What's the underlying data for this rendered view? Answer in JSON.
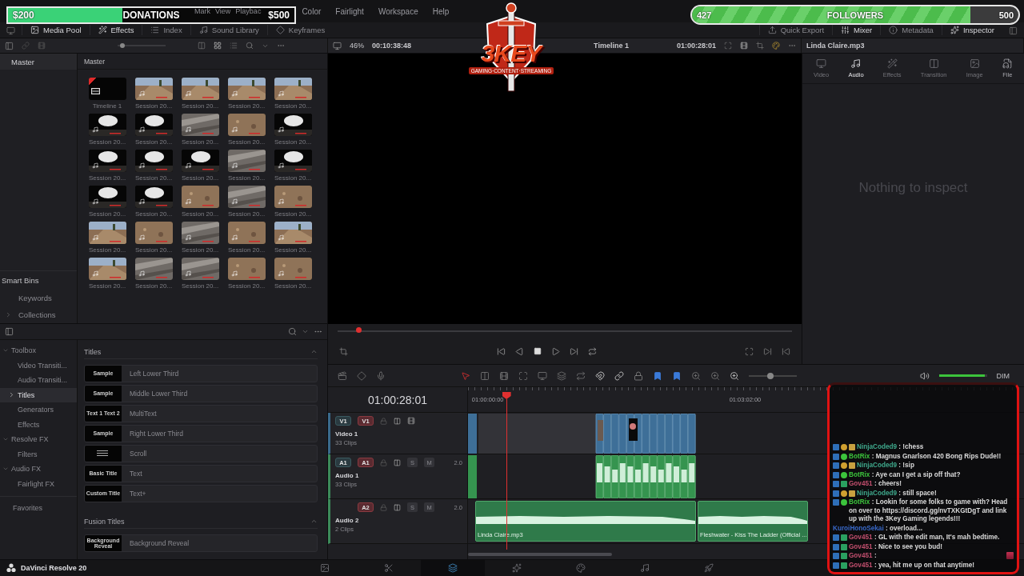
{
  "donation_goal": {
    "current": "$200",
    "label": "DONATIONS",
    "target": "$500",
    "level": 0.4
  },
  "follower_goal": {
    "current": "427",
    "label": "FOLLOWERS",
    "target": "500",
    "level": 0.854
  },
  "logo": {
    "text": "3KEY",
    "tagline": "GAMING·CONTENT·STREAMING"
  },
  "menu": [
    "Mark",
    "View",
    "Playbac",
    "Color",
    "Fairlight",
    "Workspace",
    "Help"
  ],
  "toolbar_left": [
    {
      "label": "Media Pool",
      "selected": true
    },
    {
      "label": "Effects",
      "selected": true
    },
    {
      "label": "Index",
      "selected": false
    },
    {
      "label": "Sound Library",
      "selected": false
    },
    {
      "label": "Keyframes",
      "selected": false
    }
  ],
  "toolbar_right": [
    {
      "label": "Quick Export",
      "selected": false
    },
    {
      "label": "Mixer",
      "selected": true
    },
    {
      "label": "Metadata",
      "selected": false
    },
    {
      "label": "Inspector",
      "selected": true
    }
  ],
  "viewer": {
    "zoom": "46%",
    "duration": "00:10:38:48",
    "timeline": "Timeline 1",
    "timecode": "01:00:28:01",
    "scrub": {
      "level": 0.045
    }
  },
  "bins": {
    "master": "Master",
    "smart_bins": "Smart Bins",
    "items": [
      "Keywords",
      "Collections"
    ]
  },
  "media_pool": {
    "title": "Master",
    "thumb_size": {
      "level": 0.1
    },
    "clips": [
      {
        "kind": "timeline",
        "label": "Timeline 1"
      },
      {
        "kind": "clip",
        "label": "Session 20..."
      },
      {
        "kind": "clip",
        "label": "Session 20..."
      },
      {
        "kind": "clip",
        "label": "Session 20..."
      },
      {
        "kind": "clip",
        "label": "Session 20..."
      },
      {
        "kind": "clip",
        "label": "Session 20..."
      },
      {
        "kind": "clip",
        "label": "Session 20..."
      },
      {
        "kind": "clip",
        "label": "Session 20..."
      },
      {
        "kind": "clip",
        "label": "Session 20..."
      },
      {
        "kind": "clip",
        "label": "Session 20..."
      },
      {
        "kind": "clip",
        "label": "Session 20..."
      },
      {
        "kind": "clip",
        "label": "Session 20..."
      },
      {
        "kind": "clip",
        "label": "Session 20..."
      },
      {
        "kind": "clip",
        "label": "Session 20..."
      },
      {
        "kind": "clip",
        "label": "Session 20..."
      },
      {
        "kind": "clip",
        "label": "Session 20..."
      },
      {
        "kind": "clip",
        "label": "Session 20..."
      },
      {
        "kind": "clip",
        "label": "Session 20..."
      },
      {
        "kind": "clip",
        "label": "Session 20..."
      },
      {
        "kind": "clip",
        "label": "Session 20..."
      },
      {
        "kind": "clip",
        "label": "Session 20..."
      },
      {
        "kind": "clip",
        "label": "Session 20..."
      },
      {
        "kind": "clip",
        "label": "Session 20..."
      },
      {
        "kind": "clip",
        "label": "Session 20..."
      },
      {
        "kind": "clip",
        "label": "Session 20..."
      },
      {
        "kind": "clip",
        "label": "Session 20..."
      },
      {
        "kind": "clip",
        "label": "Session 20..."
      },
      {
        "kind": "clip",
        "label": "Session 20..."
      },
      {
        "kind": "clip",
        "label": "Session 20..."
      },
      {
        "kind": "clip",
        "label": "Session 20..."
      }
    ]
  },
  "inspector": {
    "title": "Linda Claire.mp3",
    "tabs": [
      {
        "label": "Video",
        "selected": false,
        "disabled": true
      },
      {
        "label": "Audio",
        "selected": true,
        "disabled": false
      },
      {
        "label": "Effects",
        "selected": false,
        "disabled": true
      },
      {
        "label": "Transition",
        "selected": false,
        "disabled": true
      },
      {
        "label": "Image",
        "selected": false,
        "disabled": true
      },
      {
        "label": "File",
        "selected": false,
        "disabled": false
      }
    ],
    "empty": "Nothing to inspect"
  },
  "effects": {
    "tree": [
      {
        "label": "Toolbox",
        "expanded": true,
        "children": [
          {
            "label": "Video Transiti...",
            "selected": false
          },
          {
            "label": "Audio Transiti...",
            "selected": false
          },
          {
            "label": "Titles",
            "selected": true
          },
          {
            "label": "Generators",
            "selected": false
          },
          {
            "label": "Effects",
            "selected": false
          }
        ]
      },
      {
        "label": "Resolve FX",
        "expanded": true,
        "children": [
          {
            "label": "Filters",
            "selected": false
          }
        ]
      },
      {
        "label": "Audio FX",
        "expanded": true,
        "children": [
          {
            "label": "Fairlight FX",
            "selected": false
          }
        ]
      }
    ],
    "favorites": "Favorites",
    "sections": [
      {
        "title": "Titles",
        "expanded": true,
        "items": [
          {
            "name": "Left Lower Third",
            "preview": "Sample"
          },
          {
            "name": "Middle Lower Third",
            "preview": "Sample"
          },
          {
            "name": "MultiText",
            "preview": "Text 1 Text 2"
          },
          {
            "name": "Right Lower Third",
            "preview": "Sample"
          },
          {
            "name": "Scroll"
          },
          {
            "name": "Text",
            "preview": "Basic Title"
          },
          {
            "name": "Text+",
            "preview": "Custom Title"
          }
        ]
      },
      {
        "title": "Fusion Titles",
        "expanded": true,
        "items": [
          {
            "name": "Background Reveal",
            "preview": "Background Reveal"
          }
        ]
      }
    ]
  },
  "timeline": {
    "timecode": "01:00:28:01",
    "ruler": [
      "01:00:00:00",
      "01:03:02:00"
    ],
    "playhead": {
      "level": 0.07
    },
    "zoom": {
      "level": 0.45
    },
    "volume": {
      "level": 0.95
    },
    "dim": "DIM",
    "tracks": [
      {
        "kind": "video",
        "dest": "V1",
        "src": "V1",
        "name": "Video 1",
        "count": "33 Clips"
      },
      {
        "kind": "audio",
        "dest": "A1",
        "src": "A1",
        "name": "Audio 1",
        "count": "33 Clips",
        "solo": "S",
        "mute": "M",
        "channels": "2.0"
      },
      {
        "kind": "audio",
        "src": "A2",
        "name": "Audio 2",
        "count": "2 Clips",
        "solo": "S",
        "mute": "M",
        "channels": "2.0",
        "clips": [
          "Linda Claire.mp3",
          "Fleshwater - Kiss The Ladder (Official ..."
        ]
      }
    ]
  },
  "chat": [
    {
      "kind": "vip",
      "user": "NinjaCoded9",
      "color": "#3fa98c",
      "text": ": !chess",
      "emote": false
    },
    {
      "kind": "bot",
      "user": "BotRix",
      "color": "#3cc43c",
      "text": ": Magnus Gnarlson 420 Bong Rips Dude!!",
      "emote": false
    },
    {
      "kind": "vip",
      "user": "NinjaCoded9",
      "color": "#3fa98c",
      "text": ": !sip",
      "emote": false
    },
    {
      "kind": "bot",
      "user": "BotRix",
      "color": "#3cc43c",
      "text": ": Aye can I get a sip off that?",
      "emote": false
    },
    {
      "kind": "sub",
      "user": "Gov451",
      "color": "#c24f6e",
      "text": ": cheers!",
      "emote": false
    },
    {
      "kind": "vip",
      "user": "NinjaCoded9",
      "color": "#3fa98c",
      "text": ": still space!",
      "emote": false
    },
    {
      "kind": "bot",
      "user": "BotRix",
      "color": "#3cc43c",
      "text": ": Lookin for some folks to game with? Head on over to https://discord.gg/nvTXKGtDgT and link up with the 3Key Gaming legends!!!",
      "emote": false
    },
    {
      "kind": "plain",
      "user": "KuroiHonoSekai",
      "color": "#3868c8",
      "text": ": overload...",
      "emote": false
    },
    {
      "kind": "sub",
      "user": "Gov451",
      "color": "#c24f6e",
      "text": ": GL with the edit man, It's mah bedtime.",
      "emote": false
    },
    {
      "kind": "sub",
      "user": "Gov451",
      "color": "#c24f6e",
      "text": ": Nice to see you bud!",
      "emote": false
    },
    {
      "kind": "sub",
      "user": "Gov451",
      "color": "#c24f6e",
      "text": ":",
      "emote": true
    },
    {
      "kind": "sub",
      "user": "Gov451",
      "color": "#c24f6e",
      "text": ": yea, hit me up on that anytime!",
      "emote": false
    }
  ],
  "footer": {
    "app": "DaVinci Resolve 20",
    "pages": [
      {
        "kind": "media",
        "selected": false
      },
      {
        "kind": "cut",
        "selected": false
      },
      {
        "kind": "edit",
        "selected": true
      },
      {
        "kind": "fusion",
        "selected": false
      },
      {
        "kind": "color",
        "selected": false
      },
      {
        "kind": "fairlight",
        "selected": false
      },
      {
        "kind": "deliver",
        "selected": false
      }
    ]
  }
}
